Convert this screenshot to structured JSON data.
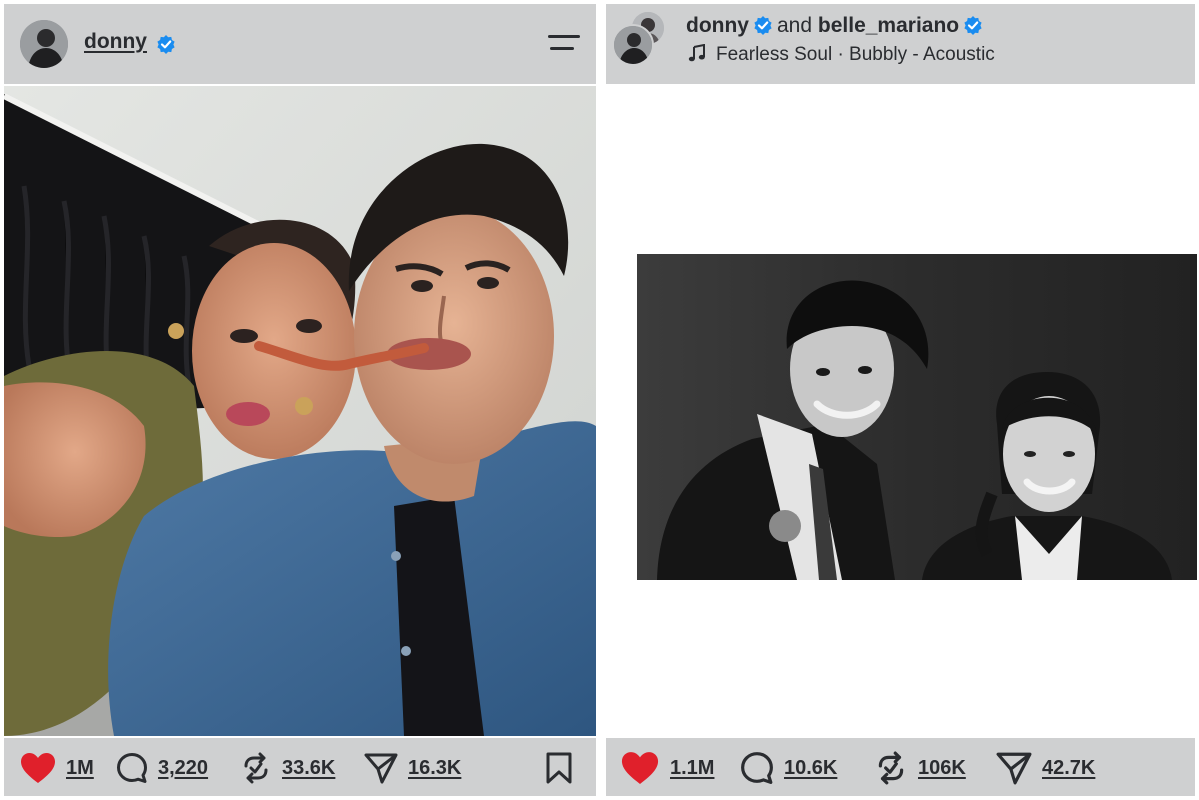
{
  "left_post": {
    "username": "donny",
    "actions": {
      "likes": "1M",
      "comments": "3,220",
      "reposts": "33.6K",
      "shares": "16.3K"
    }
  },
  "right_post": {
    "collab": {
      "user1": "donny",
      "joiner": "and",
      "user2": "belle_mariano"
    },
    "music": "Fearless Soul · Bubbly - Acoustic",
    "actions": {
      "likes": "1.1M",
      "comments": "10.6K",
      "reposts": "106K",
      "shares": "42.7K"
    }
  },
  "colors": {
    "bar_bg": "#cfd0d1",
    "text": "#2a2c30",
    "like_red": "#e0202b",
    "verified_blue": "#1a8cf0"
  },
  "icons": [
    "verified-badge-icon",
    "menu-icon",
    "music-note-icon",
    "heart-icon",
    "comment-icon",
    "repost-icon",
    "share-icon",
    "bookmark-icon"
  ]
}
